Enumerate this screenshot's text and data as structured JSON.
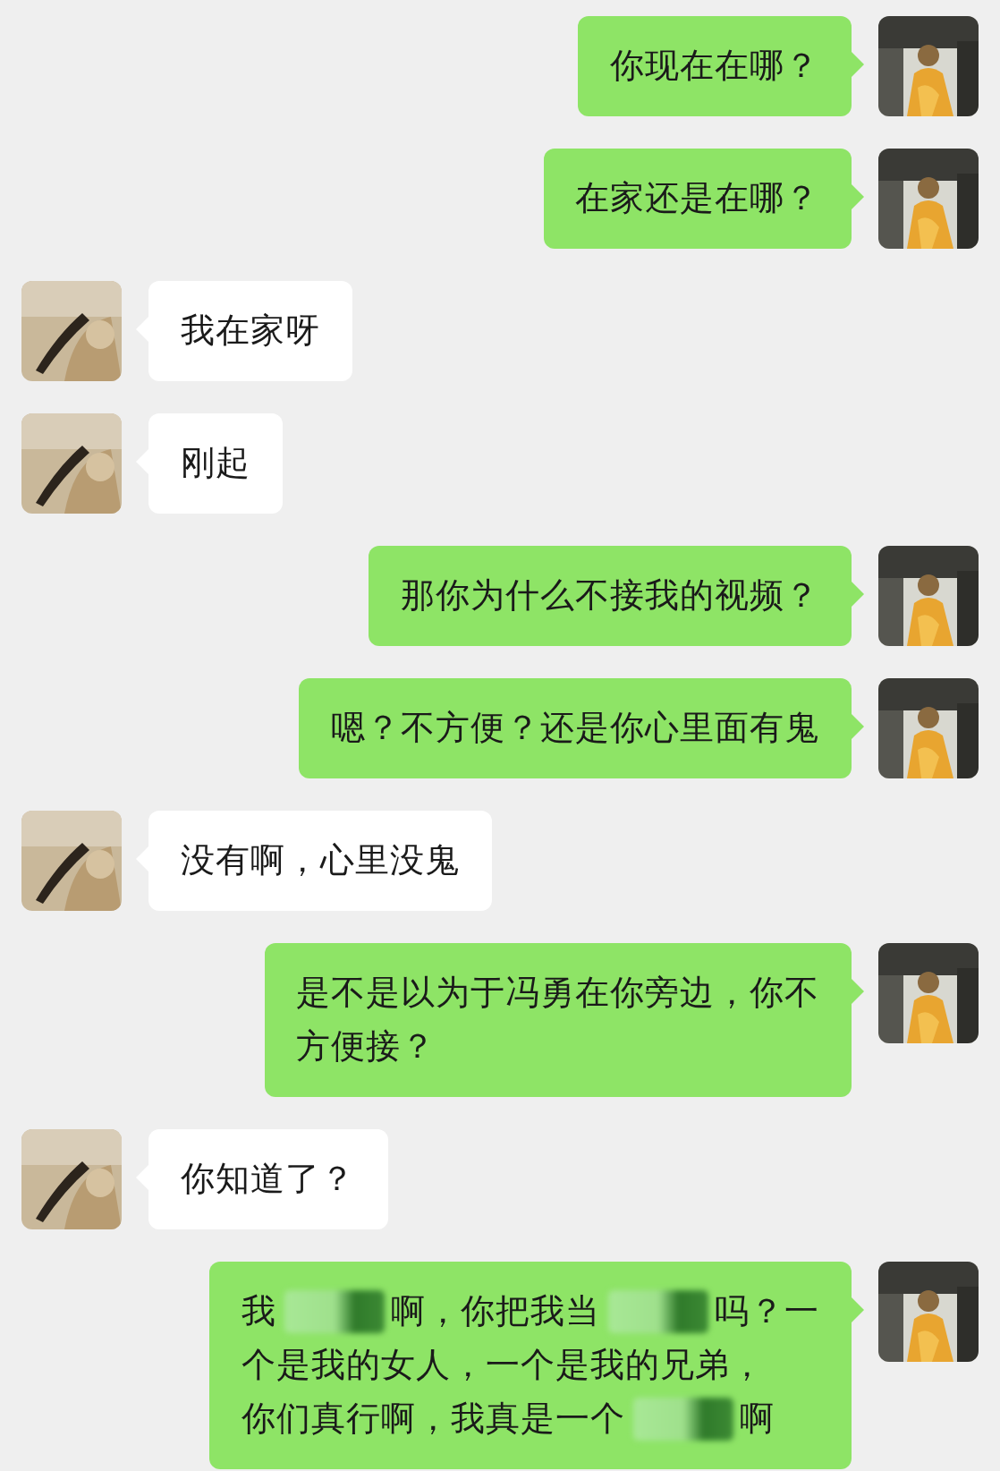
{
  "messages": [
    {
      "kind": "sent",
      "lines": [
        [
          {
            "kind": "text",
            "text": "你现在在哪？"
          }
        ]
      ]
    },
    {
      "kind": "sent",
      "lines": [
        [
          {
            "kind": "text",
            "text": "在家还是在哪？"
          }
        ]
      ]
    },
    {
      "kind": "received",
      "lines": [
        [
          {
            "kind": "text",
            "text": "我在家呀"
          }
        ]
      ]
    },
    {
      "kind": "received",
      "lines": [
        [
          {
            "kind": "text",
            "text": "刚起"
          }
        ]
      ]
    },
    {
      "kind": "sent",
      "lines": [
        [
          {
            "kind": "text",
            "text": "那你为什么不接我的视频？"
          }
        ]
      ]
    },
    {
      "kind": "sent",
      "lines": [
        [
          {
            "kind": "text",
            "text": "嗯？不方便？还是你心里面有鬼"
          }
        ]
      ]
    },
    {
      "kind": "received",
      "lines": [
        [
          {
            "kind": "text",
            "text": "没有啊，心里没鬼"
          }
        ]
      ]
    },
    {
      "kind": "sent",
      "lines": [
        [
          {
            "kind": "text",
            "text": "是不是以为于冯勇在你旁边，你不"
          }
        ],
        [
          {
            "kind": "text",
            "text": "方便接？"
          }
        ]
      ]
    },
    {
      "kind": "received",
      "lines": [
        [
          {
            "kind": "text",
            "text": "你知道了？"
          }
        ]
      ]
    },
    {
      "kind": "sent",
      "lines": [
        [
          {
            "kind": "text",
            "text": "我"
          },
          {
            "kind": "redacted"
          },
          {
            "kind": "text",
            "text": "啊，你把我当"
          },
          {
            "kind": "redacted"
          },
          {
            "kind": "text",
            "text": "吗？一"
          }
        ],
        [
          {
            "kind": "text",
            "text": "个是我的女人，一个是我的兄弟，"
          }
        ],
        [
          {
            "kind": "text",
            "text": "你们真行啊，我真是一个"
          },
          {
            "kind": "redacted"
          },
          {
            "kind": "text",
            "text": "啊"
          }
        ]
      ]
    }
  ]
}
